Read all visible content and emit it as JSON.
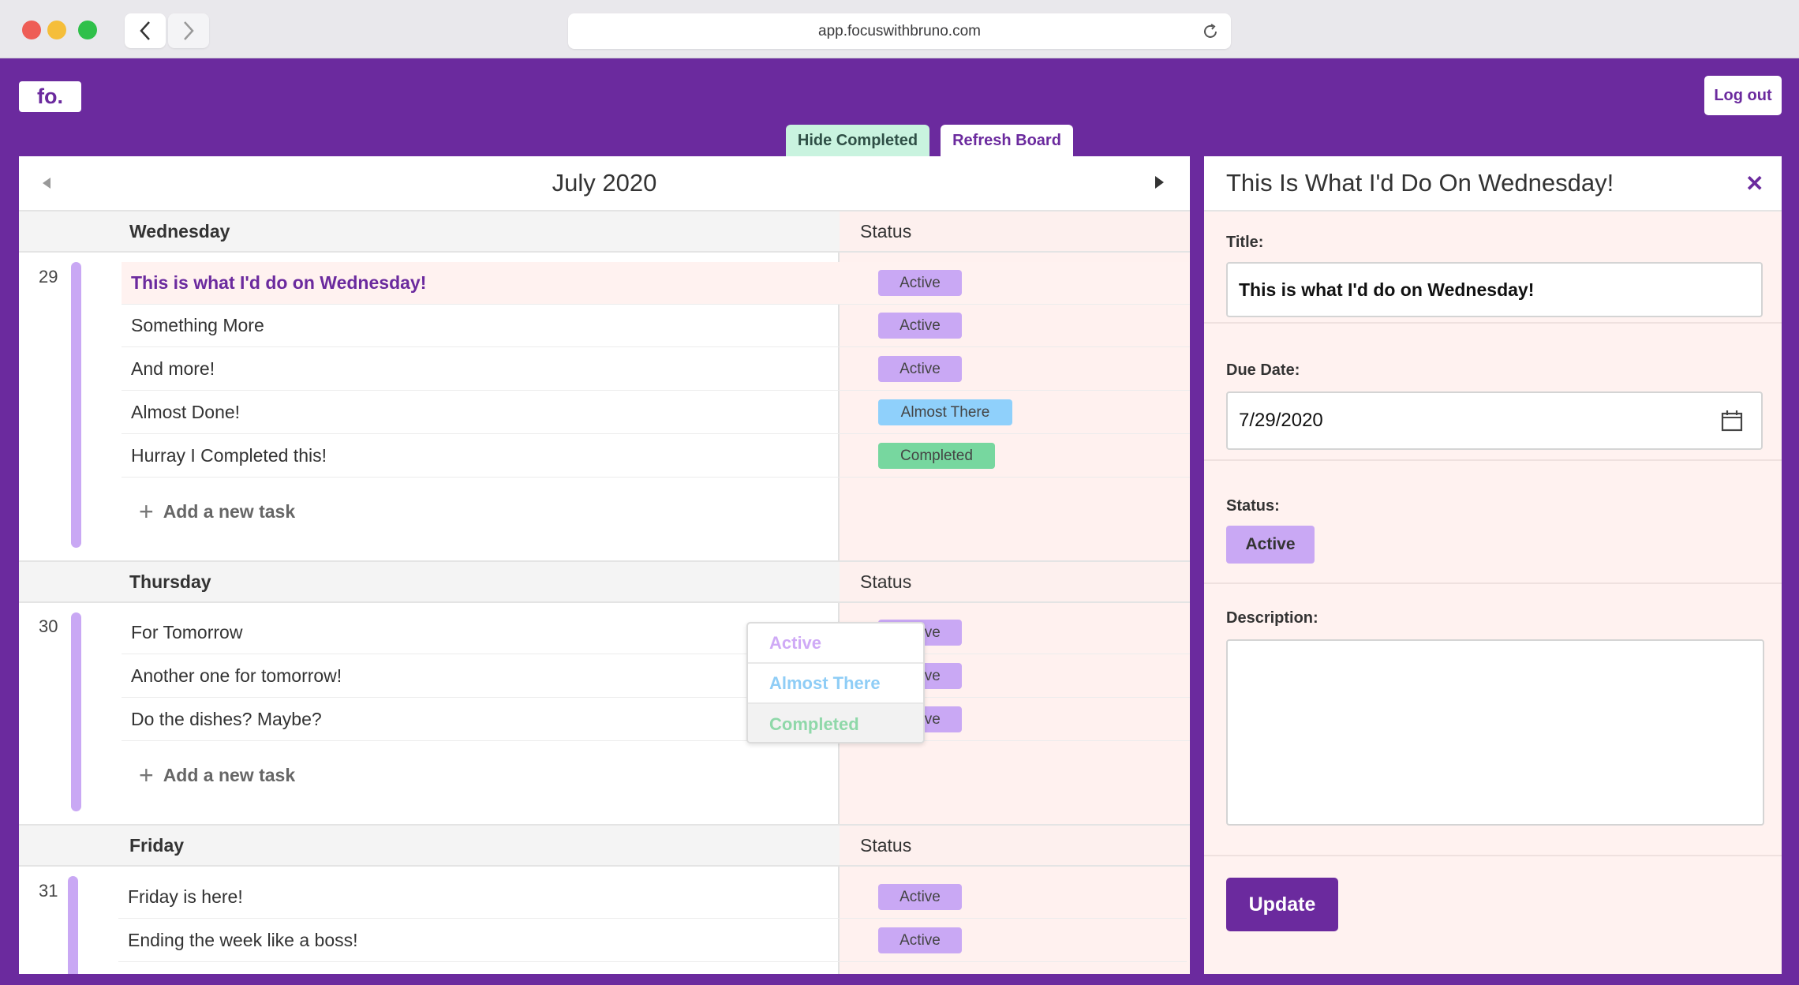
{
  "browser": {
    "url": "app.focuswithbruno.com"
  },
  "header": {
    "logo": "fo.",
    "logout_label": "Log out",
    "hide_completed_label": "Hide Completed",
    "refresh_board_label": "Refresh Board"
  },
  "board": {
    "month": "July 2020",
    "status_header": "Status",
    "add_task_label": "Add a new task",
    "days": [
      {
        "name": "Wednesday",
        "number": "29",
        "tasks": [
          {
            "title": "This is what I'd do on Wednesday!",
            "status": "Active"
          },
          {
            "title": "Something More",
            "status": "Active"
          },
          {
            "title": "And more!",
            "status": "Active"
          },
          {
            "title": "Almost Done!",
            "status": "Almost There"
          },
          {
            "title": "Hurray I Completed this!",
            "status": "Completed"
          }
        ]
      },
      {
        "name": "Thursday",
        "number": "30",
        "tasks": [
          {
            "title": "For Tomorrow",
            "status": "Active"
          },
          {
            "title": "Another one for tomorrow!",
            "status": "Active"
          },
          {
            "title": "Do the dishes? Maybe?",
            "status": "Active"
          }
        ]
      },
      {
        "name": "Friday",
        "number": "31",
        "tasks": [
          {
            "title": "Friday is here!",
            "status": "Active"
          },
          {
            "title": "Ending the week like a boss!",
            "status": "Active"
          }
        ]
      }
    ]
  },
  "status_dropdown": {
    "options": [
      "Active",
      "Almost There",
      "Completed"
    ]
  },
  "detail": {
    "heading": "This Is What I'd Do On Wednesday!",
    "title_label": "Title:",
    "title_value": "This is what I'd do on Wednesday!",
    "due_label": "Due Date:",
    "due_value": "7/29/2020",
    "status_label": "Status:",
    "status_value": "Active",
    "description_label": "Description:",
    "description_value": "",
    "update_label": "Update"
  },
  "colors": {
    "brand": "#6b2a9e",
    "active": "#c9a8f4",
    "almost_there": "#8fd0fb",
    "completed": "#77d79f"
  }
}
